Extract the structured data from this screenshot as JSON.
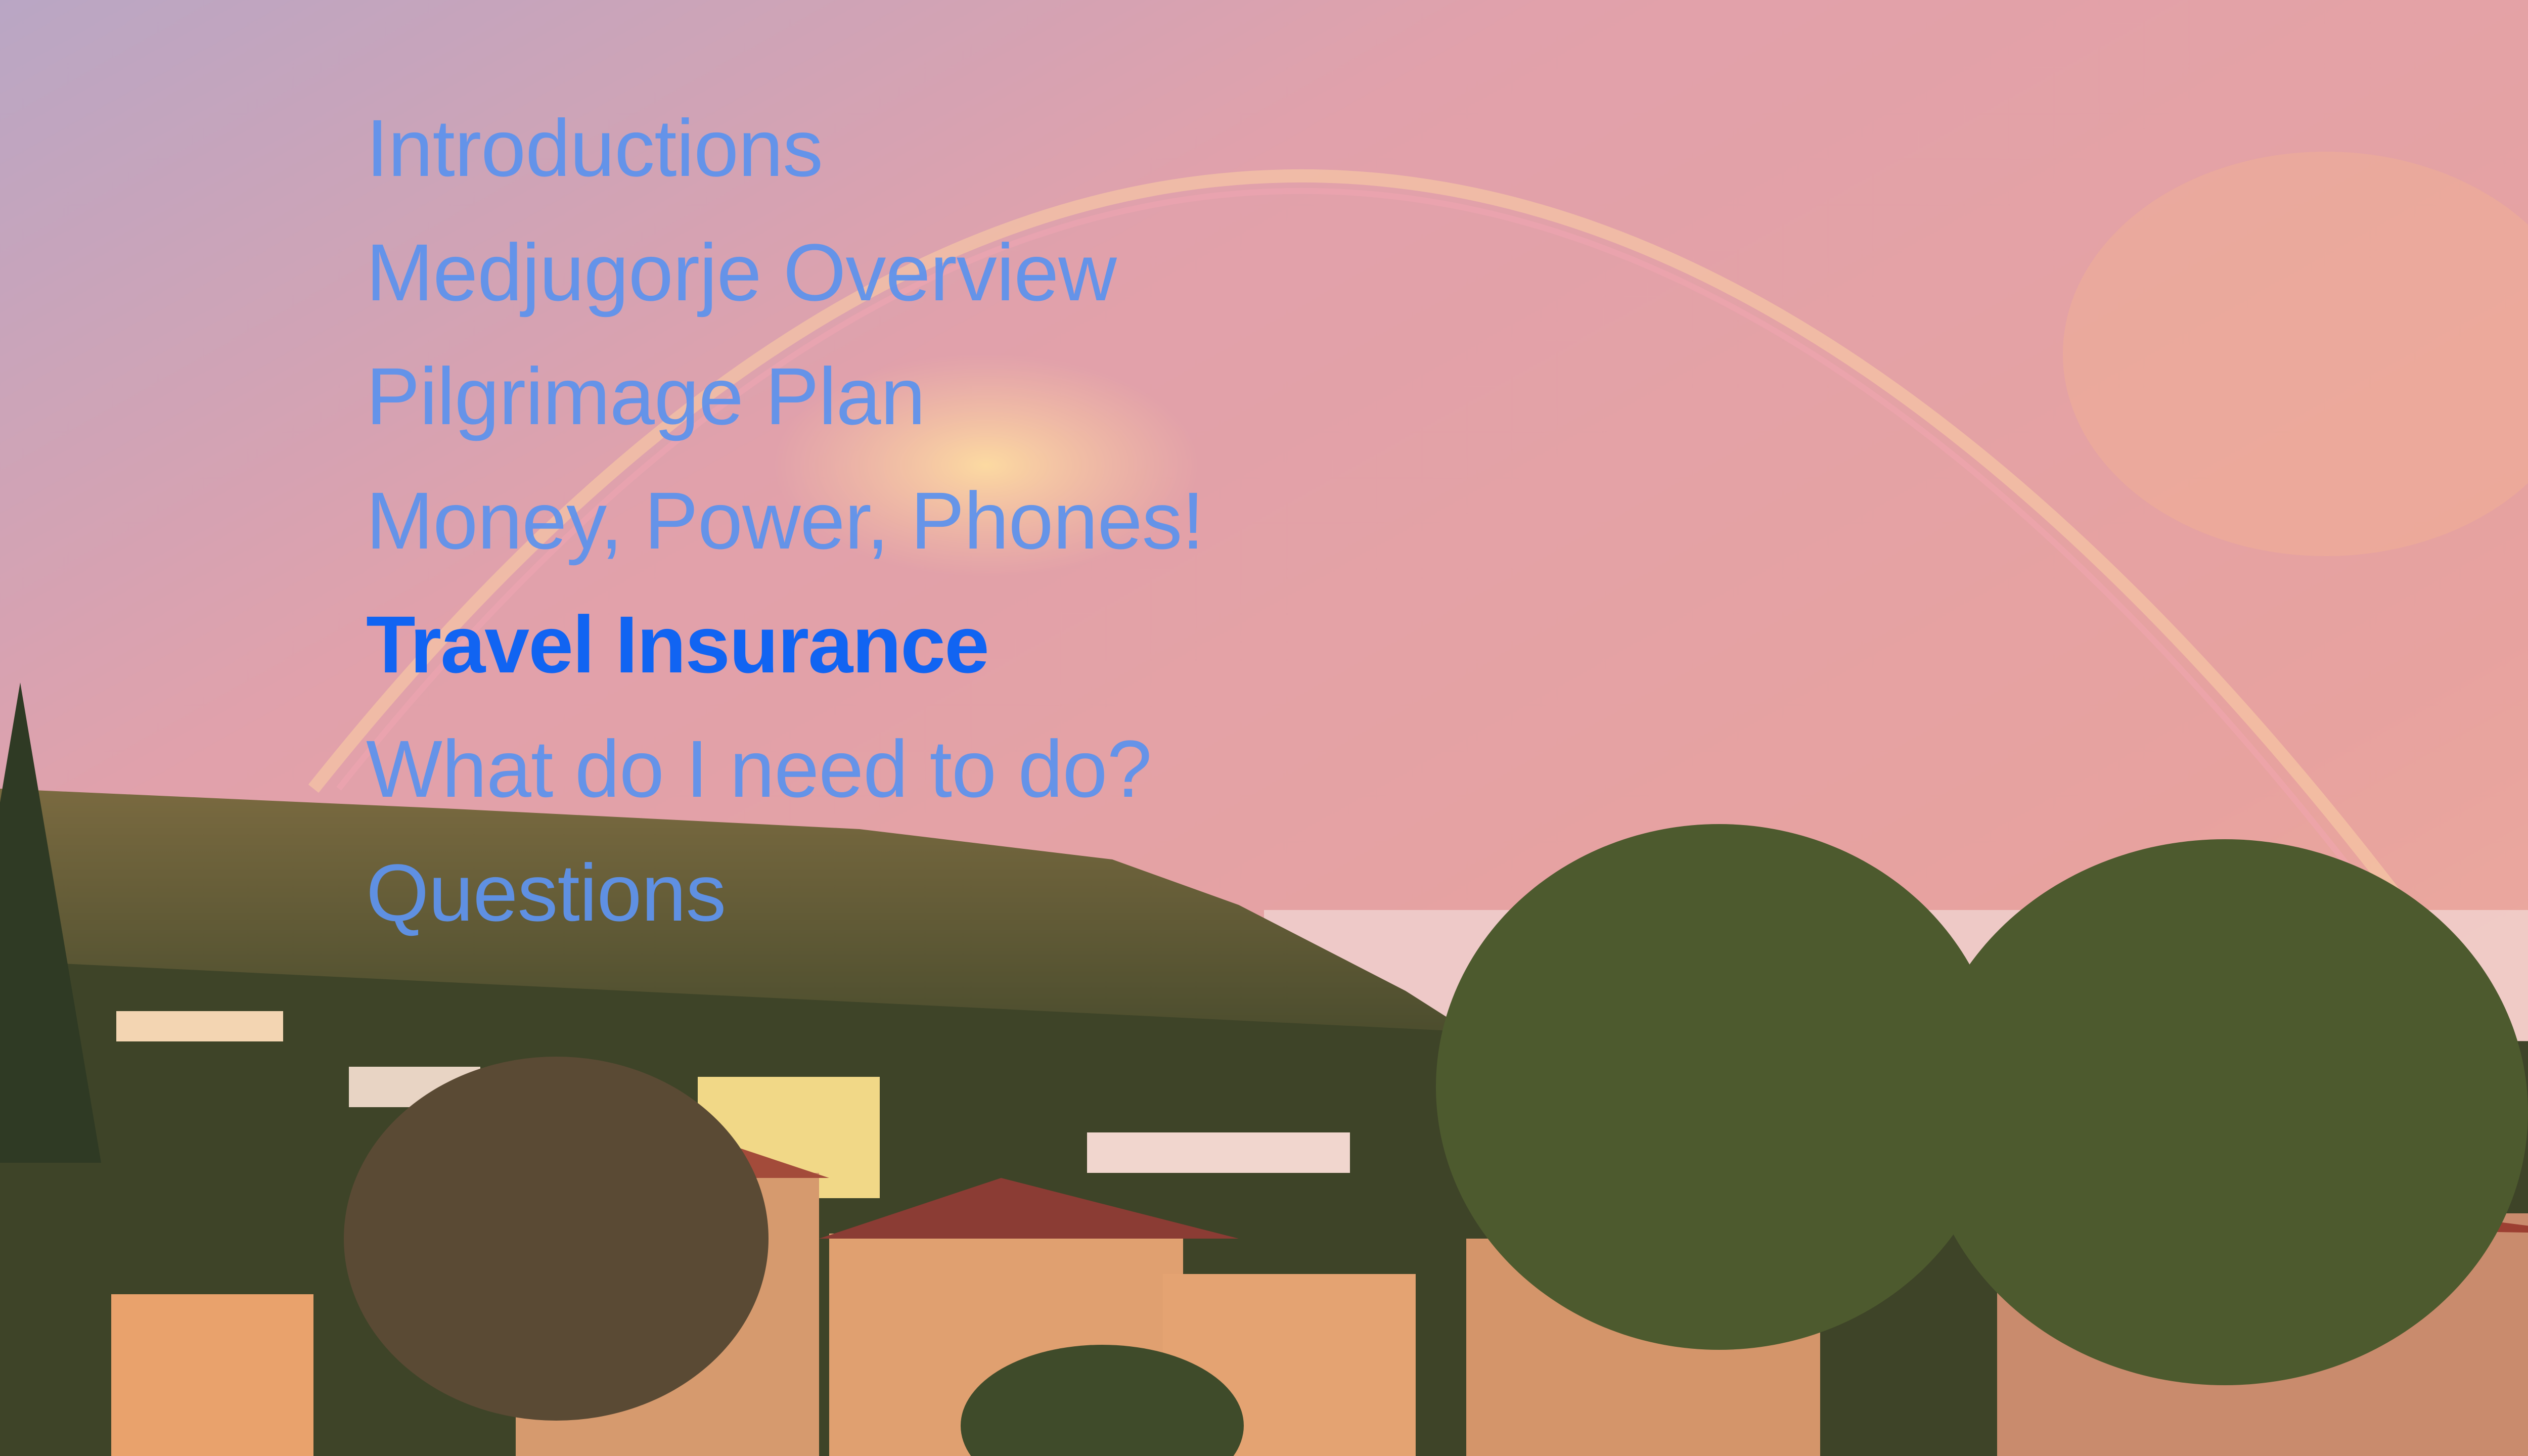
{
  "slide": {
    "agenda": [
      {
        "label": "Introductions",
        "active": false
      },
      {
        "label": "Medjugorje Overview",
        "active": false
      },
      {
        "label": "Pilgrimage Plan",
        "active": false
      },
      {
        "label": "Money, Power, Phones!",
        "active": false
      },
      {
        "label": "Travel Insurance",
        "active": true
      },
      {
        "label": "What do I need to do?",
        "active": false
      },
      {
        "label": "Questions",
        "active": false
      }
    ],
    "colors": {
      "item_text": "#5f93ec",
      "active_text": "#1164f2",
      "sky": "#e8a6a8",
      "hill": "#5a5a3a"
    }
  }
}
